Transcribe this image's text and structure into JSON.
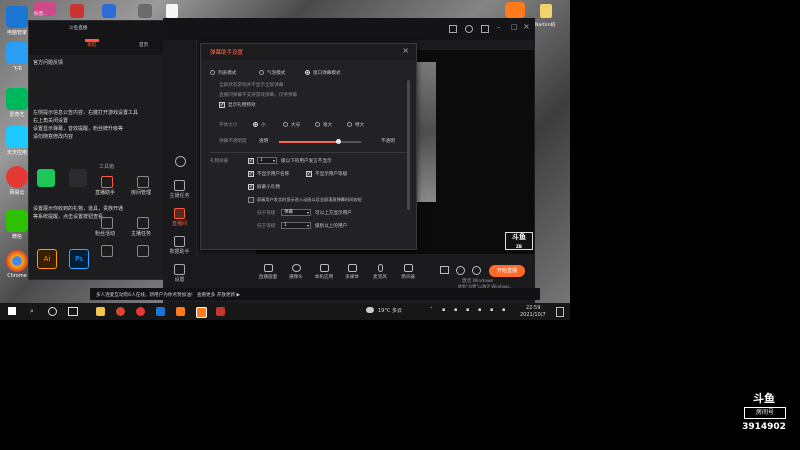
{
  "desktop": {
    "labels": [
      "电脑管家",
      "飞书",
      "爱奇艺",
      "天天应用",
      "网易云",
      "微信",
      "Chrome",
      "Ai",
      "Ps",
      "Vivaldi",
      "新建文件夹",
      "Blender",
      "Steam",
      "抖音"
    ],
    "icon_colors": [
      "#1976d2",
      "#2a9df4",
      "#00b85c",
      "#1ec9ff",
      "#e53935",
      "#2dc100",
      "#f4b400",
      "#3a1e00",
      "#0b2b4a",
      "#ef3939",
      "#f1c232",
      "#ff7700",
      "#1b2838",
      "#111111"
    ]
  },
  "top": {
    "left_title": "抖音…",
    "center_title": "斗鱼直播",
    "right_icon_label": "Nartim机"
  },
  "left_panel": {
    "title": "官方问题反馈",
    "lines": [
      "左侧提示信息公告内容，右键打开游戏设置工具",
      "右上角关闭设置",
      "设置显示弹幕，音效提醒，粉丝牌升级等",
      "请勿随意修改内容"
    ],
    "footer_lines": [
      "设置展示你收到的礼物，道具，贵族开通",
      "等系统提醒，点击设置按钮查看"
    ],
    "section_label": "工具箱",
    "grid_labels": [
      "直播助手",
      "房间管理",
      "粉丝活动",
      "主播任务",
      "下载插件",
      "更多"
    ]
  },
  "app": {
    "nav": [
      "主播任务",
      "直播间",
      "数据助手",
      "设置"
    ],
    "tab_labels": [
      "发起",
      "首页"
    ],
    "watermark": "斗鱼",
    "watermark_sub": "ZB"
  },
  "dialog": {
    "title": "弹幕助手设置",
    "close": "×",
    "modes": [
      "列表模式",
      "气泡模式",
      "窗口弹幕模式"
    ],
    "mode_selected": 2,
    "hint1": "全屏状态游戏并不显示全屏弹幕",
    "hint2": "直播间弹幕不支持游戏弹幕，仅供弹幕",
    "show_effects": "显示礼物特效",
    "font_size_label": "字体大小",
    "font_sizes": [
      "小",
      "大号",
      "很大",
      "特大"
    ],
    "opacity_label": "弹幕不透明度",
    "opacity_left": "透明",
    "opacity_right": "不透明",
    "opacity_value": 0.72,
    "filter_label": "礼物屏蔽",
    "filter_value": "1",
    "filter_desc": "级以下的用户发言不显示",
    "cb1": "不显示用户名称",
    "cb2": "不显示用户等级",
    "cb3": "屏蔽小礼物",
    "cb4": "屏蔽用户发言时显示进入动画以及全屏滚屏弹幕时间较短",
    "row1_label": "低于等级",
    "row1_value": "弹幕",
    "row1_desc": "可以上方显示用户",
    "row2_label": "低于等级",
    "row2_value": "1",
    "row2_desc": "级别以上的用户"
  },
  "bottom_tools": [
    "直播画面",
    "摄像头",
    "本机应用",
    "多媒体",
    "麦克风",
    "扬声器"
  ],
  "start_live": "开始直播",
  "notification": "多人连麦互动有6人在线，新用户为你点赞加油！ 查看更多 开放更新 ▶",
  "activate": "激活 Windows",
  "activate_sub": "转到“设置”以激活 Windows。",
  "live_time": "00:00:00",
  "taskbar": {
    "weather": "19°C 多云",
    "time": "22:59",
    "date": "2021/10/7"
  },
  "douyu_logo": {
    "top": "斗鱼",
    "mid": "房间号",
    "room_number": "3914902"
  }
}
